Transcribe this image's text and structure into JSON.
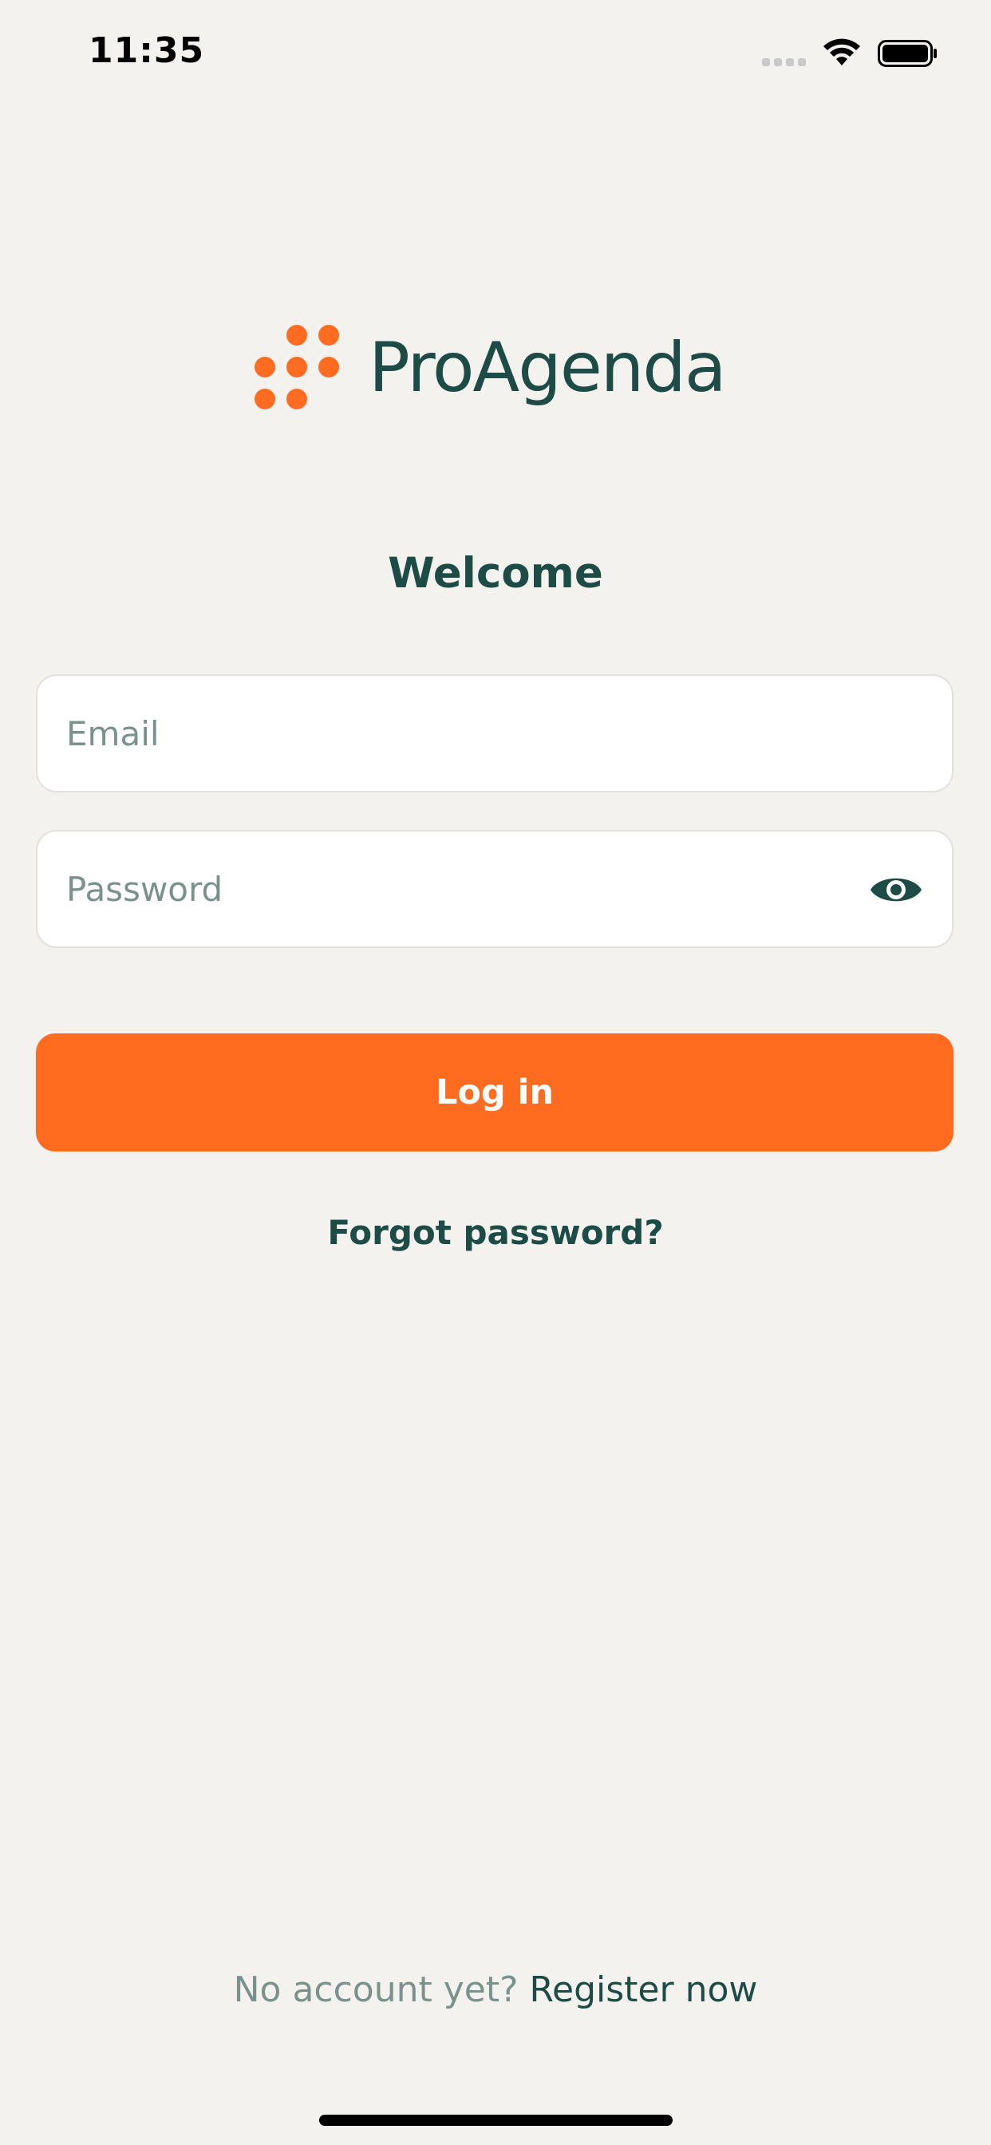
{
  "status_bar": {
    "time": "11:35",
    "icons": [
      "signal-icon",
      "wifi-icon",
      "battery-icon"
    ]
  },
  "brand": {
    "name": "ProAgenda",
    "icon": "dots-logo-icon",
    "accent_color": "#ff6b1f",
    "text_color": "#1d4b45"
  },
  "login": {
    "title": "Welcome",
    "email_placeholder": "Email",
    "email_value": "",
    "password_placeholder": "Password",
    "password_value": "",
    "password_toggle_icon": "eye-icon",
    "submit_label": "Log in",
    "forgot_label": "Forgot password?"
  },
  "footer": {
    "prompt": "No account yet?",
    "register_label": "Register now"
  },
  "colors": {
    "background": "#f4f2ee",
    "primary_button": "#ff6b1f",
    "placeholder": "#7a928e"
  }
}
